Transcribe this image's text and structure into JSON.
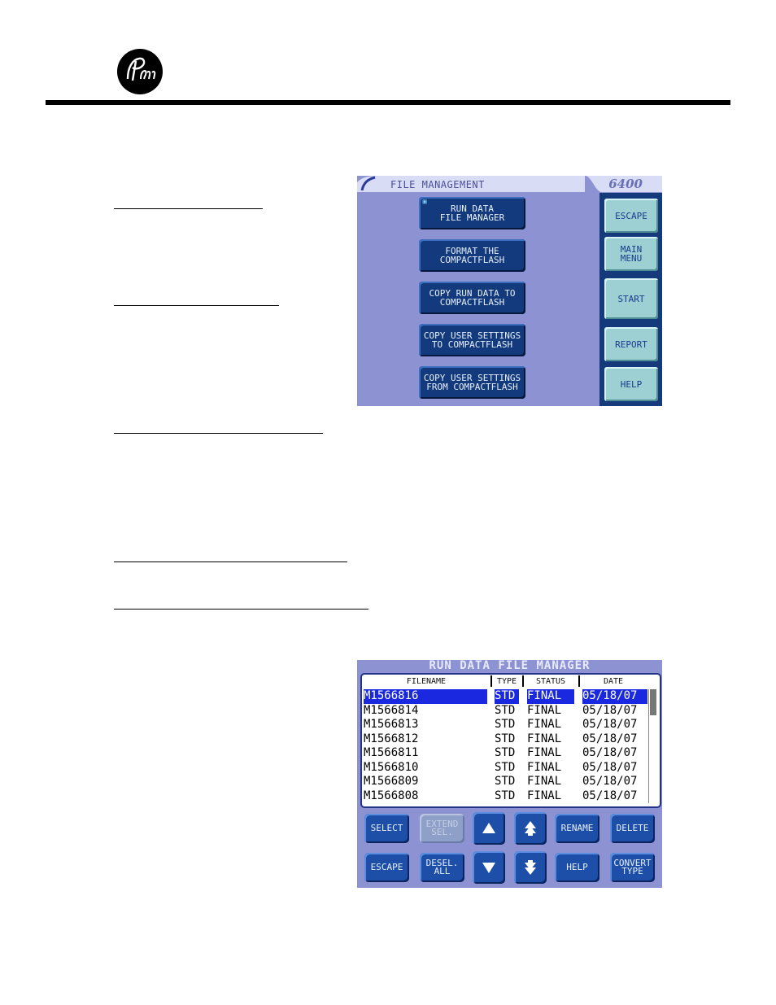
{
  "screen1": {
    "title": "FILE MANAGEMENT",
    "model": "6400",
    "menu_buttons": [
      "RUN DATA\nFILE MANAGER",
      "FORMAT THE\nCOMPACTFLASH",
      "COPY RUN DATA TO\nCOMPACTFLASH",
      "COPY USER SETTINGS\nTO COMPACTFLASH",
      "COPY USER SETTINGS\nFROM COMPACTFLASH"
    ],
    "side_buttons": [
      "ESCAPE",
      "MAIN\nMENU",
      "START",
      "REPORT",
      "HELP"
    ]
  },
  "screen2": {
    "title": "RUN DATA FILE MANAGER",
    "columns": [
      "FILENAME",
      "TYPE",
      "STATUS",
      "DATE"
    ],
    "rows": [
      {
        "filename": "M1566816",
        "type": "STD",
        "status": "FINAL",
        "date": "05/18/07",
        "selected": true
      },
      {
        "filename": "M1566814",
        "type": "STD",
        "status": "FINAL",
        "date": "05/18/07"
      },
      {
        "filename": "M1566813",
        "type": "STD",
        "status": "FINAL",
        "date": "05/18/07"
      },
      {
        "filename": "M1566812",
        "type": "STD",
        "status": "FINAL",
        "date": "05/18/07"
      },
      {
        "filename": "M1566811",
        "type": "STD",
        "status": "FINAL",
        "date": "05/18/07"
      },
      {
        "filename": "M1566810",
        "type": "STD",
        "status": "FINAL",
        "date": "05/18/07"
      },
      {
        "filename": "M1566809",
        "type": "STD",
        "status": "FINAL",
        "date": "05/18/07"
      },
      {
        "filename": "M1566808",
        "type": "STD",
        "status": "FINAL",
        "date": "05/18/07"
      }
    ],
    "buttons": {
      "select": "SELECT",
      "extend_sel": "EXTEND\nSEL.",
      "rename": "RENAME",
      "delete": "DELETE",
      "escape": "ESCAPE",
      "deselect_all": "DESEL.\nALL",
      "help": "HELP",
      "convert_type": "CONVERT\nTYPE"
    }
  },
  "colors": {
    "screen_bg": "#8d92d2",
    "nav_button": "#123a7c",
    "side_button": "#9cd0d3",
    "selection": "#1a28e0"
  },
  "icons": [
    "parr-logo",
    "arrow-up-icon",
    "page-up-icon",
    "arrow-down-icon",
    "page-down-icon"
  ]
}
